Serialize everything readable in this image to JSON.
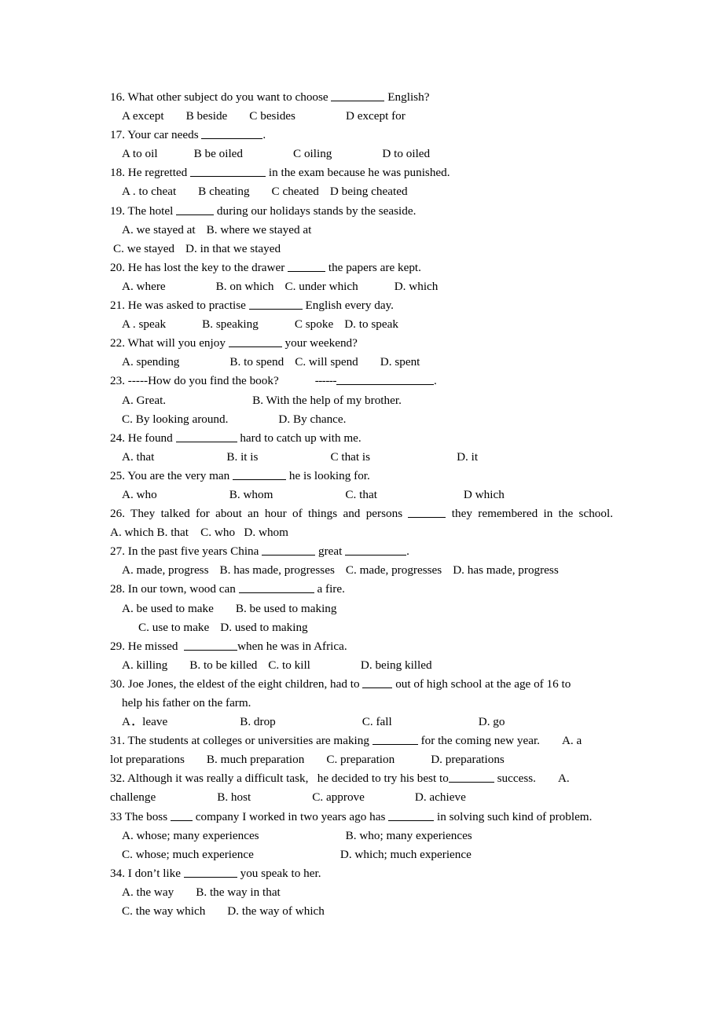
{
  "document": {
    "type": "english-grammar-multiple-choice-worksheet",
    "questions": [
      {
        "number": "16.",
        "stem_before": "16. What other subject do you want to choose ",
        "stem_after": " English?",
        "options_line": "A except",
        "opt_b": "B beside",
        "opt_c": "C besides",
        "opt_d": "D except for"
      },
      {
        "number": "17.",
        "stem_before": "17. Your car needs ",
        "stem_after": ".",
        "options_line": "A to oil",
        "opt_b": "B be oiled",
        "opt_c": "C oiling",
        "opt_d": "D to oiled"
      },
      {
        "number": "18.",
        "stem_before": "18. He regretted ",
        "stem_after": " in the exam because he was punished.",
        "options_line": "A . to cheat",
        "opt_b": "B cheating",
        "opt_c": "C cheated",
        "opt_d": "D being cheated"
      },
      {
        "number": "19.",
        "stem_before": "19. The hotel ",
        "stem_after": " during our holidays stands by the seaside.",
        "opt_a": "A. we stayed at",
        "opt_b": "B. where we stayed at",
        "opt_c": "C. we stayed",
        "opt_d": "D. in that we stayed"
      },
      {
        "number": "20.",
        "stem_before": "20. He has lost the key to the drawer ",
        "stem_after": " the papers are kept.",
        "opt_a": "A. where",
        "opt_b": "B. on which",
        "opt_c": "C. under which",
        "opt_d": "D. which"
      },
      {
        "number": "21.",
        "stem_before": "21. He was asked to practise ",
        "stem_after": " English every day.",
        "opt_a": "A . speak",
        "opt_b": "B. speaking",
        "opt_c": "C spoke",
        "opt_d": "D. to speak"
      },
      {
        "number": "22.",
        "stem_before": "22. What will you enjoy ",
        "stem_after": " your weekend?",
        "opt_a": "A. spending",
        "opt_b": "B. to spend",
        "opt_c": "C. will spend",
        "opt_d": "D. spent"
      },
      {
        "number": "23.",
        "stem_before": "23. -----How do you find the book?",
        "stem_dashes": "------",
        "stem_after": ".",
        "opt_a": "A. Great.",
        "opt_b": "B. With the help of my brother.",
        "opt_c": "C. By looking around.",
        "opt_d": "D. By chance."
      },
      {
        "number": "24.",
        "stem_before": "24. He found ",
        "stem_after": " hard to catch up with me.",
        "opt_a": "A. that",
        "opt_b": "B. it is",
        "opt_c": "C that is",
        "opt_d": "D. it"
      },
      {
        "number": "25.",
        "stem_before": "25. You are the very man ",
        "stem_after": " he is looking for.",
        "opt_a": "A. who",
        "opt_b": "B. whom",
        "opt_c": "C. that",
        "opt_d": "D which"
      },
      {
        "number": "26.",
        "stem_before": "26. They talked for about an hour of things and persons ",
        "stem_after": " they remembered in the school.",
        "options_line": "A. which B. that    C. who   D. whom"
      },
      {
        "number": "27.",
        "stem_before": "27. In the past five years China ",
        "stem_mid": " great ",
        "stem_after": ".",
        "opt_a": "A. made, progress",
        "opt_b": "B. has made, progresses",
        "opt_c": "C. made, progresses",
        "opt_d": "D. has made, progress"
      },
      {
        "number": "28.",
        "stem_before": "28. In our town, wood can ",
        "stem_after": " a fire.",
        "opt_a": "A. be used to make",
        "opt_b": "B. be used to making",
        "opt_c": "C. use to make",
        "opt_d": "D. used to making"
      },
      {
        "number": "29.",
        "stem_before": "29. He missed  ",
        "stem_after": "when he was in Africa.",
        "opt_a": "A. killing",
        "opt_b": "B. to be killed",
        "opt_c": "C. to kill",
        "opt_d": "D. being killed"
      },
      {
        "number": "30.",
        "stem_before": "30. Joe Jones, the eldest of the eight children, had to ",
        "stem_after": " out of high school at the age of 16 to",
        "stem_wrap": "help his father on the farm.",
        "opt_a": "A．leave",
        "opt_b": "B. drop",
        "opt_c": "C. fall",
        "opt_d": "D. go"
      },
      {
        "number": "31.",
        "stem_before": "31. The students at colleges or universities are making ",
        "stem_after": " for the coming new year.",
        "opt_a_head": "A. a",
        "opt_a_tail": "lot preparations",
        "opt_b": "B. much preparation",
        "opt_c": "C. preparation",
        "opt_d": "D. preparations"
      },
      {
        "number": "32.",
        "stem_before": "32. Although it was really a difficult task,   he decided to try his best to",
        "stem_after": " success.",
        "opt_a_head": "A.",
        "opt_a_tail": "challenge",
        "opt_b": "B. host",
        "opt_c": "C. approve",
        "opt_d": "D. achieve"
      },
      {
        "number": "33",
        "stem_before": "33 The boss ",
        "stem_mid": " company I worked in two years ago has ",
        "stem_after": " in solving such kind of problem.",
        "opt_a": "A. whose; many experiences",
        "opt_b": "B. who; many experiences",
        "opt_c": "C. whose; much experience",
        "opt_d": "D. which; much experience"
      },
      {
        "number": "34.",
        "stem_before": "34. I don’t like ",
        "stem_after": " you speak to her.",
        "opt_a": "A. the way",
        "opt_b": "B. the way in that",
        "opt_c": "C. the way which",
        "opt_d": "D. the way of which"
      }
    ]
  }
}
